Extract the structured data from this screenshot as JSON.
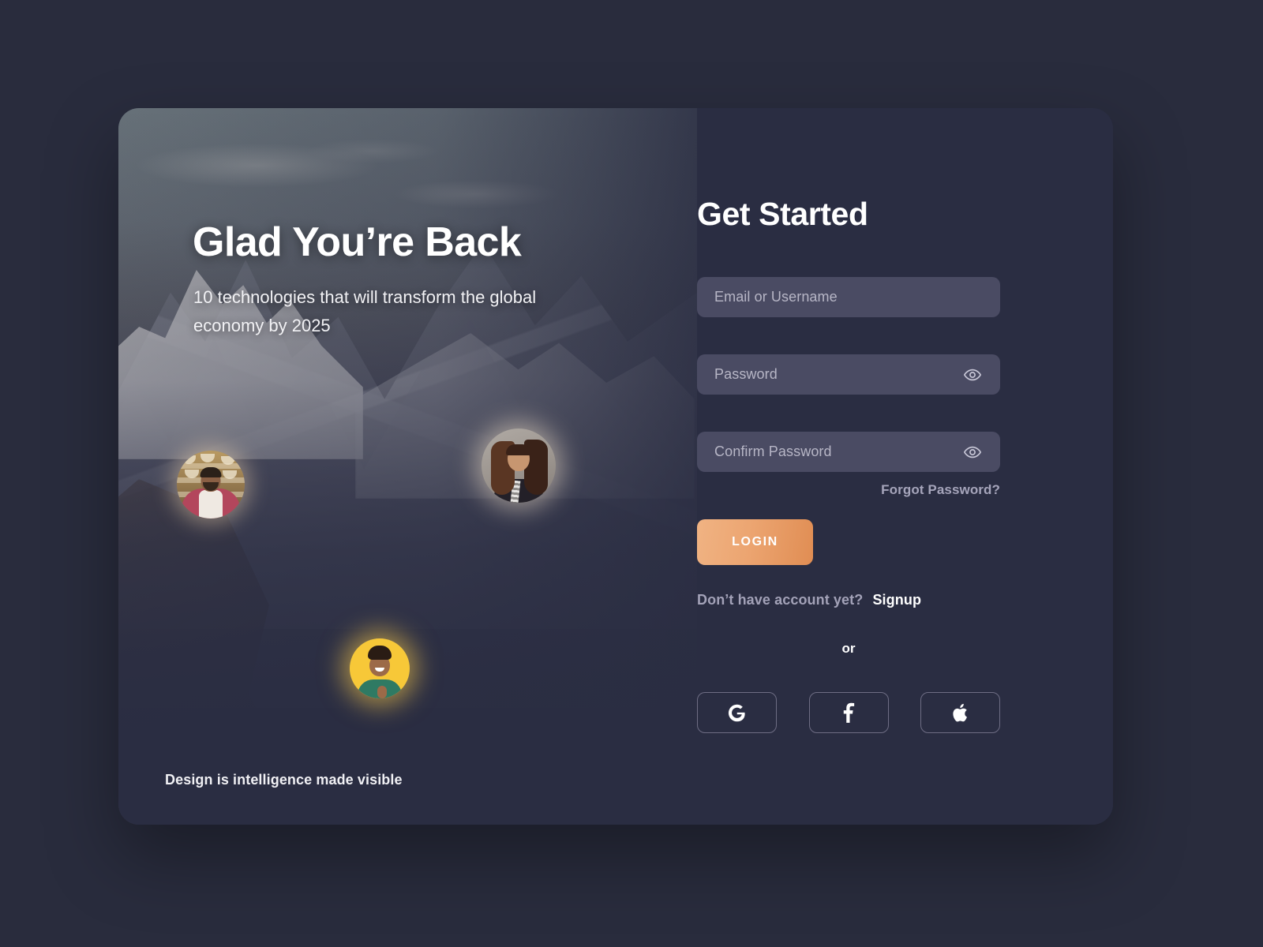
{
  "theme": {
    "page_bg": "#292c3d",
    "card_bg": "#2a2d42",
    "field_bg": "#4a4b63",
    "accent_from": "#f0b383",
    "accent_to": "#e08d53",
    "muted_text": "#a3a2b8",
    "avatar_gold": "#f7c838"
  },
  "hero": {
    "title": "Glad You’re Back",
    "subtitle": "10 technologies that will transform the global economy by 2025",
    "tagline": "Design is intelligence made visible",
    "avatars": [
      {
        "name": "avatar-shop-owner",
        "alt": "Man in apron standing in a shop"
      },
      {
        "name": "avatar-woman",
        "alt": "Smiling woman with long dark hair"
      },
      {
        "name": "avatar-young-man",
        "alt": "Young man smiling on yellow background"
      }
    ]
  },
  "form": {
    "title": "Get Started",
    "fields": [
      {
        "name": "email",
        "placeholder": "Email or Username",
        "value": "",
        "has_eye": false
      },
      {
        "name": "password",
        "placeholder": "Password",
        "value": "",
        "has_eye": true
      },
      {
        "name": "confirm_password",
        "placeholder": "Confirm Password",
        "value": "",
        "has_eye": true
      }
    ],
    "forgot_label": "Forgot Password?",
    "submit_label": "LOGIN",
    "signup_prompt": "Don’t have account yet?",
    "signup_link": "Signup",
    "divider_label": "or",
    "social": [
      {
        "name": "google",
        "icon": "google-icon",
        "label": "G"
      },
      {
        "name": "facebook",
        "icon": "facebook-icon",
        "label": "f"
      },
      {
        "name": "apple",
        "icon": "apple-icon",
        "label": ""
      }
    ]
  }
}
